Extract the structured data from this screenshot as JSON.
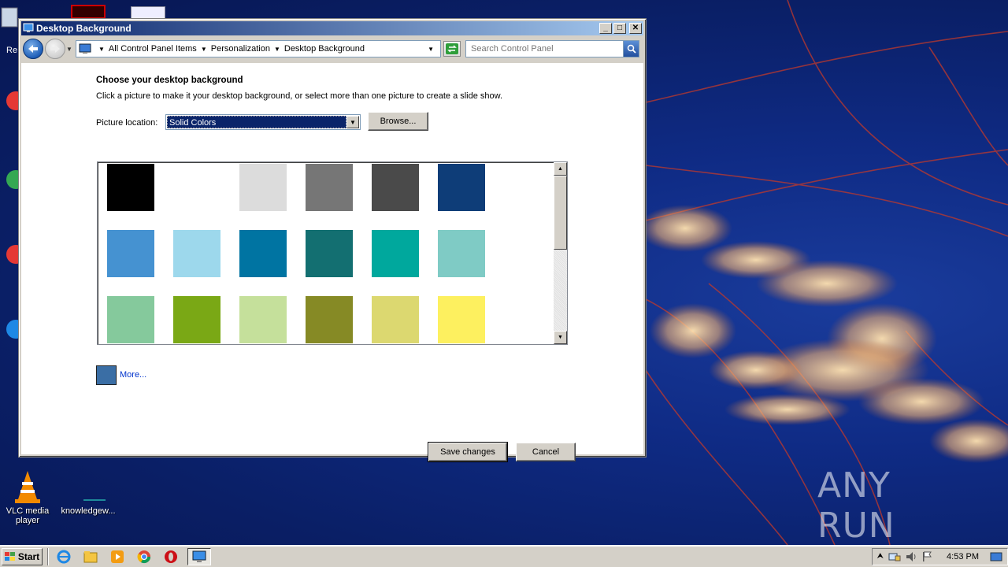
{
  "window": {
    "title": "Desktop Background",
    "minimize": "_",
    "maximize": "□",
    "close": "✕"
  },
  "navbar": {
    "breadcrumbs": [
      "All Control Panel Items",
      "Personalization",
      "Desktop Background"
    ],
    "search_placeholder": "Search Control Panel"
  },
  "content": {
    "heading": "Choose your desktop background",
    "subtext": "Click a picture to make it your desktop background, or select more than one picture to create a slide show.",
    "location_label": "Picture location:",
    "location_value": "Solid Colors",
    "browse_label": "Browse...",
    "swatches": [
      "#000000",
      "#ffffff",
      "#dcdcdc",
      "#767676",
      "#4a4a4a",
      "#0e3d78",
      "#4592d1",
      "#9dd8ec",
      "#0074a2",
      "#136f71",
      "#00a89d",
      "#7fcbc5",
      "#85c99c",
      "#7aa815",
      "#c5e09b",
      "#868a25",
      "#dcd870",
      "#fdf05f"
    ],
    "more_color": "#3a6ea5",
    "more_label": "More...",
    "save_label": "Save changes",
    "cancel_label": "Cancel"
  },
  "desktop": {
    "icons": [
      {
        "label": "VLC media player"
      },
      {
        "label": "knowledgew..."
      }
    ],
    "partial_labels": [
      "Re"
    ],
    "watermark": "ANY RUN"
  },
  "taskbar": {
    "start_label": "Start",
    "pinned": [
      "ie-icon",
      "explorer-icon",
      "media-player-icon",
      "chrome-icon",
      "opera-icon"
    ],
    "clock": "4:53 PM"
  }
}
